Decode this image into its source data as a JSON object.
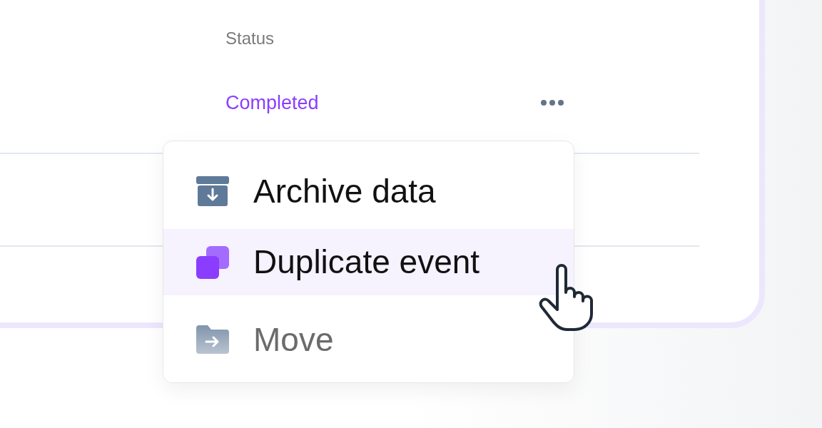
{
  "table": {
    "columns": [
      "Status"
    ],
    "rows": [
      {
        "status": "Completed"
      }
    ]
  },
  "context_menu": {
    "items": [
      {
        "kind": "archive",
        "label": "Archive data",
        "selected": false,
        "disabled": false
      },
      {
        "kind": "duplicate",
        "label": "Duplicate event",
        "selected": true,
        "disabled": false
      },
      {
        "kind": "move",
        "label": "Move",
        "selected": false,
        "disabled": true
      }
    ]
  }
}
